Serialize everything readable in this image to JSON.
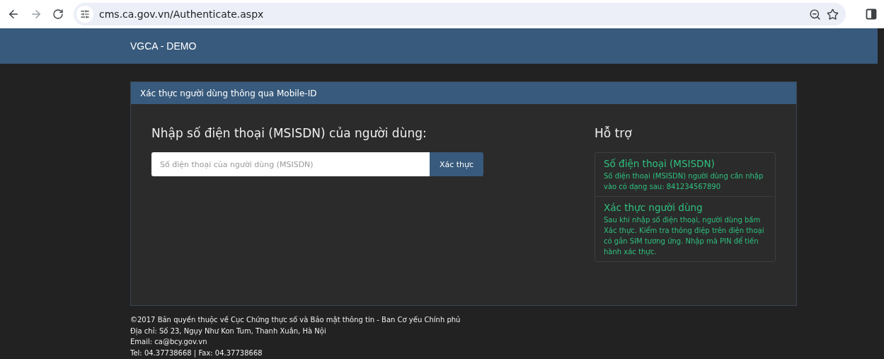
{
  "browser": {
    "url": "cms.ca.gov.vn/Authenticate.aspx"
  },
  "navbar": {
    "brand": "VGCA - DEMO"
  },
  "panel": {
    "title": "Xác thực người dùng thông qua Mobile-ID",
    "form": {
      "heading": "Nhập số điện thoại (MSISDN) của người dùng:",
      "placeholder": "Số điện thoại của người dùng (MSISDN)",
      "button": "Xác thực"
    },
    "help": {
      "heading": "Hỗ trợ",
      "items": [
        {
          "title": "Số điện thoại (MSISDN)",
          "text": "Số điện thoại (MSISDN) người dùng cần nhập vào có dạng sau: 841234567890"
        },
        {
          "title": "Xác thực người dùng",
          "text": "Sau khi nhập số điện thoại, người dùng bấm Xác thực. Kiểm tra thông điệp trên điện thoại có gắn SIM tương ứng. Nhập mã PIN để tiến hành xác thực."
        }
      ]
    }
  },
  "footer": [
    "©2017 Bản quyền thuộc về Cục Chứng thực số và Bảo mật thông tin - Ban Cơ yếu Chính phủ",
    "Địa chỉ: Số 23, Ngụy Như Kon Tum, Thanh Xuân, Hà Nội",
    "Email: ca@bcy.gov.vn",
    "Tel: 04.37738668 | Fax: 04.37738668"
  ]
}
